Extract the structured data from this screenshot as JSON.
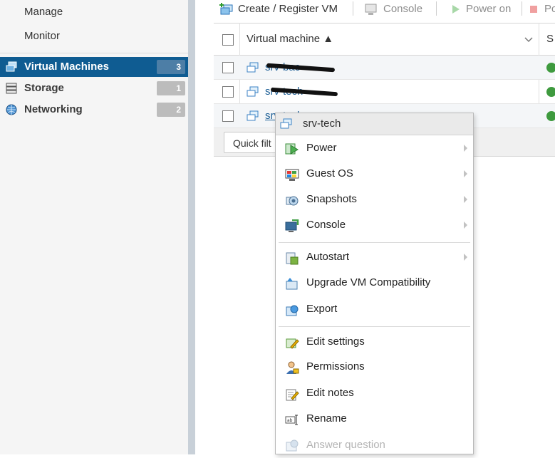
{
  "sidebar": {
    "sub_items": [
      "Manage",
      "Monitor"
    ],
    "items": [
      {
        "label": "Virtual Machines",
        "count": "3",
        "icon": "vm-icon",
        "active": true
      },
      {
        "label": "Storage",
        "count": "1",
        "icon": "storage-icon",
        "active": false
      },
      {
        "label": "Networking",
        "count": "2",
        "icon": "network-icon",
        "active": false
      }
    ]
  },
  "toolbar": {
    "create_register": "Create / Register VM",
    "console": "Console",
    "power_on": "Power on",
    "power_off_partial": "Pc"
  },
  "grid": {
    "header": {
      "vm_column": "Virtual machine ▲",
      "status_column_partial": "S"
    },
    "rows": [
      {
        "name": "srv-bac",
        "status": "ok"
      },
      {
        "name": "srv-tech",
        "status": "ok"
      },
      {
        "name": "srv-tech",
        "status": "ok"
      }
    ],
    "quick_filter": "Quick filt"
  },
  "context_menu": {
    "title": "srv-tech",
    "items": [
      {
        "label": "Power",
        "submenu": true,
        "icon": "power-icon"
      },
      {
        "label": "Guest OS",
        "submenu": true,
        "icon": "guest-os-icon"
      },
      {
        "label": "Snapshots",
        "submenu": true,
        "icon": "snapshots-icon"
      },
      {
        "label": "Console",
        "submenu": true,
        "icon": "console-icon"
      },
      {
        "label": "Autostart",
        "submenu": true,
        "icon": "autostart-icon"
      },
      {
        "label": "Upgrade VM Compatibility",
        "submenu": false,
        "icon": "upgrade-icon"
      },
      {
        "label": "Export",
        "submenu": false,
        "icon": "export-icon"
      },
      {
        "label": "Edit settings",
        "submenu": false,
        "icon": "edit-settings-icon"
      },
      {
        "label": "Permissions",
        "submenu": false,
        "icon": "permissions-icon"
      },
      {
        "label": "Edit notes",
        "submenu": false,
        "icon": "edit-notes-icon"
      },
      {
        "label": "Rename",
        "submenu": false,
        "icon": "rename-icon"
      },
      {
        "label": "Answer question",
        "submenu": false,
        "icon": "answer-question-icon",
        "disabled": true
      }
    ]
  },
  "colors": {
    "sidebar_active": "#0f5c92",
    "link": "#1d5f96",
    "status_ok": "#3e9a3e",
    "highlight": "#ffff00"
  }
}
